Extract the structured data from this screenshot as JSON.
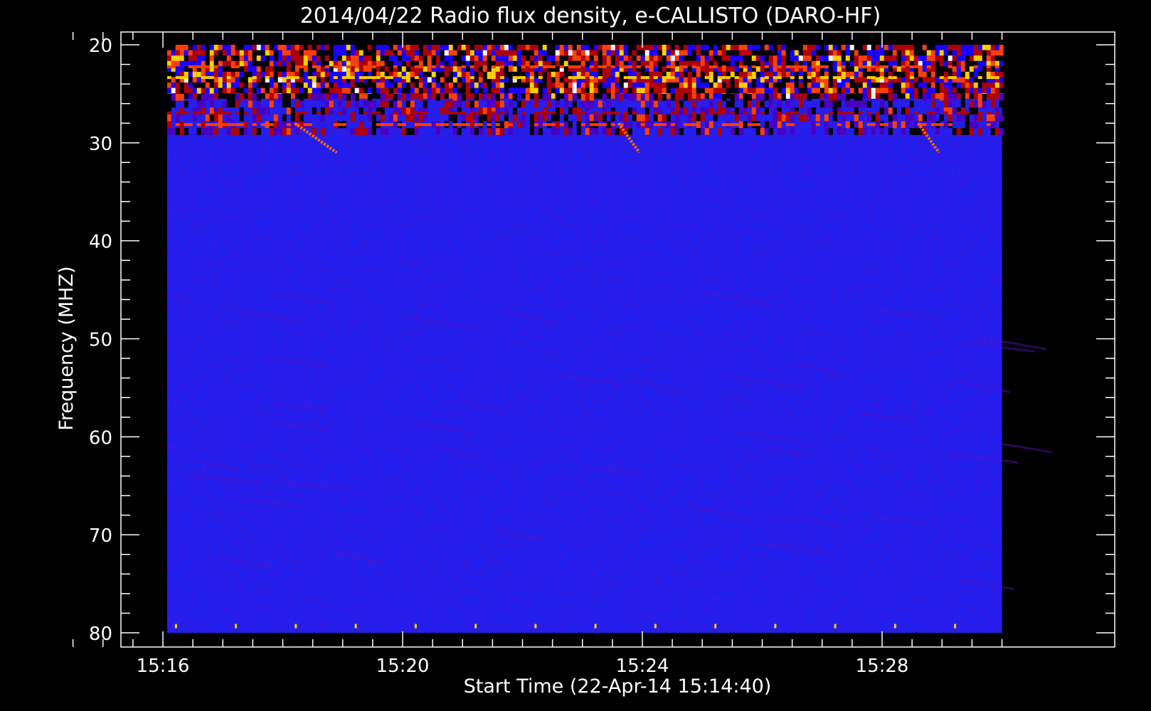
{
  "chart_data": {
    "type": "heatmap",
    "title": "2014/04/22  Radio flux density, e-CALLISTO (DARO-HF)",
    "xlabel": "Start Time (22-Apr-14 15:14:40)",
    "ylabel": "Frequency (MHZ)",
    "x_ticks": [
      "15:16",
      "15:20",
      "15:24",
      "15:28"
    ],
    "x_tick_minutes": [
      16,
      20,
      24,
      28
    ],
    "y_ticks": [
      "20",
      "30",
      "40",
      "50",
      "60",
      "70",
      "80"
    ],
    "y_tick_values": [
      20,
      30,
      40,
      50,
      60,
      70,
      80
    ],
    "xlim_minutes": [
      14.0,
      30.5
    ],
    "data_x_range_minutes": [
      15.0,
      30.0
    ],
    "ylim": [
      80,
      20
    ],
    "y_inverted": true,
    "grid": false,
    "colormap": [
      "#000000",
      "#1a00ff",
      "#b00000",
      "#ff4000",
      "#ffd000",
      "#ffffff"
    ],
    "background_color": "#1f1ff0",
    "description_bands": [
      {
        "freq_start": 20,
        "freq_end": 25,
        "level": "strong interference"
      },
      {
        "freq_start": 25,
        "freq_end": 29,
        "level": "moderate interference"
      },
      {
        "freq_start": 29,
        "freq_end": 80,
        "level": "background"
      }
    ],
    "drift_features": [
      {
        "time_start": 18.2,
        "time_end": 18.9,
        "freq_start": 28,
        "freq_end": 31
      },
      {
        "time_start": 23.6,
        "time_end": 23.95,
        "freq_start": 28,
        "freq_end": 31
      },
      {
        "time_start": 28.6,
        "time_end": 28.95,
        "freq_start": 28,
        "freq_end": 31
      }
    ]
  }
}
